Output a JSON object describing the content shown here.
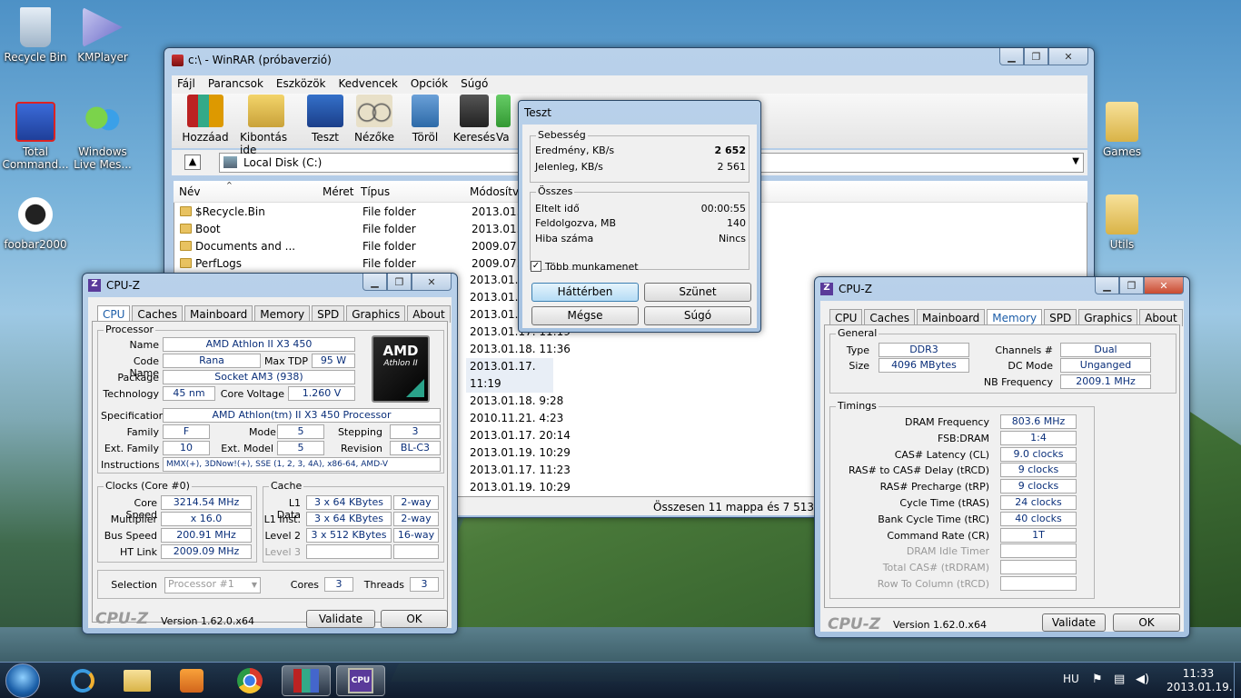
{
  "desktop": {
    "icons": [
      {
        "label": "Recycle Bin"
      },
      {
        "label": "KMPlayer"
      },
      {
        "label": "Total Command..."
      },
      {
        "label": "Windows Live Mes..."
      },
      {
        "label": "foobar2000"
      },
      {
        "label": "Games"
      },
      {
        "label": "Utils"
      }
    ]
  },
  "winrar": {
    "title": "c:\\ - WinRAR (próbaverzió)",
    "menu": [
      "Fájl",
      "Parancsok",
      "Eszközök",
      "Kedvencek",
      "Opciók",
      "Súgó"
    ],
    "toolbar": [
      "Hozzáad",
      "Kibontás ide",
      "Teszt",
      "Nézőke",
      "Töröl",
      "Keresés",
      "Va"
    ],
    "path": "Local Disk (C:)",
    "columns": [
      "Név",
      "Méret",
      "Típus",
      "Módosítva"
    ],
    "rows": [
      {
        "name": "$Recycle.Bin",
        "type": "File folder",
        "date": "2013.01.17"
      },
      {
        "name": "Boot",
        "type": "File folder",
        "date": "2013.01.17"
      },
      {
        "name": "Documents and ...",
        "type": "File folder",
        "date": "2009.07.14"
      },
      {
        "name": "PerfLogs",
        "type": "File folder",
        "date": "2009.07.14"
      }
    ],
    "more_dates": [
      "2013.01.19.",
      "2013.01.18.",
      "2013.01.17.",
      "2013.01.17. 11:19",
      "2013.01.18. 11:36",
      "2013.01.17. 11:19",
      "2013.01.18. 9:28",
      "2010.11.21. 4:23",
      "2013.01.17. 20:14",
      "2013.01.19. 10:29",
      "2013.01.17. 11:23",
      "2013.01.19. 10:29"
    ],
    "status": "Összesen 11 mappa és 7 513 565 2"
  },
  "test": {
    "title": "Teszt",
    "speed_group": "Sebesség",
    "result_label": "Eredmény, KB/s",
    "result_value": "2 652",
    "current_label": "Jelenleg, KB/s",
    "current_value": "2 561",
    "total_group": "Összes",
    "elapsed_label": "Eltelt idő",
    "elapsed_value": "00:00:55",
    "processed_label": "Feldolgozva, MB",
    "processed_value": "140",
    "errors_label": "Hiba száma",
    "errors_value": "Nincs",
    "multitask_label": "Több munkamenet",
    "buttons": [
      "Háttérben",
      "Szünet",
      "Mégse",
      "Súgó"
    ]
  },
  "cpuz1": {
    "title": "CPU-Z",
    "tabs": [
      "CPU",
      "Caches",
      "Mainboard",
      "Memory",
      "SPD",
      "Graphics",
      "About"
    ],
    "processor_group": "Processor",
    "name_l": "Name",
    "name": "AMD Athlon II X3 450",
    "codename_l": "Code Name",
    "codename": "Rana",
    "maxtdp_l": "Max TDP",
    "maxtdp": "95 W",
    "package_l": "Package",
    "package": "Socket AM3 (938)",
    "tech_l": "Technology",
    "tech": "45 nm",
    "voltage_l": "Core Voltage",
    "voltage": "1.260 V",
    "spec_l": "Specification",
    "spec": "AMD Athlon(tm) II X3 450 Processor",
    "family_l": "Family",
    "family": "F",
    "model_l": "Model",
    "model": "5",
    "stepping_l": "Stepping",
    "stepping": "3",
    "extfam_l": "Ext. Family",
    "extfam": "10",
    "extmodel_l": "Ext. Model",
    "extmodel": "5",
    "revision_l": "Revision",
    "revision": "BL-C3",
    "instr_l": "Instructions",
    "instr": "MMX(+), 3DNow!(+), SSE (1, 2, 3, 4A), x86-64, AMD-V",
    "logo_line1": "AMD",
    "logo_line2": "Athlon II",
    "clocks_group": "Clocks (Core #0)",
    "corespeed_l": "Core Speed",
    "corespeed": "3214.54 MHz",
    "mult_l": "Multiplier",
    "mult": "x 16.0",
    "bus_l": "Bus Speed",
    "bus": "200.91 MHz",
    "ht_l": "HT Link",
    "ht": "2009.09 MHz",
    "cache_group": "Cache",
    "l1d_l": "L1 Data",
    "l1d": "3 x 64 KBytes",
    "l1d_w": "2-way",
    "l1i_l": "L1 Inst.",
    "l1i": "3 x 64 KBytes",
    "l1i_w": "2-way",
    "l2_l": "Level 2",
    "l2": "3 x 512 KBytes",
    "l2_w": "16-way",
    "l3_l": "Level 3",
    "selection_l": "Selection",
    "selection": "Processor #1",
    "cores_l": "Cores",
    "cores": "3",
    "threads_l": "Threads",
    "threads": "3",
    "brand": "CPU-Z",
    "version": "Version 1.62.0.x64",
    "validate": "Validate",
    "ok": "OK"
  },
  "cpuz2": {
    "title": "CPU-Z",
    "tabs": [
      "CPU",
      "Caches",
      "Mainboard",
      "Memory",
      "SPD",
      "Graphics",
      "About"
    ],
    "general_group": "General",
    "type_l": "Type",
    "type": "DDR3",
    "channels_l": "Channels #",
    "channels": "Dual",
    "size_l": "Size",
    "size": "4096 MBytes",
    "dcmode_l": "DC Mode",
    "dcmode": "Unganged",
    "nbfreq_l": "NB Frequency",
    "nbfreq": "2009.1 MHz",
    "timings_group": "Timings",
    "timings": [
      {
        "label": "DRAM Frequency",
        "value": "803.6 MHz"
      },
      {
        "label": "FSB:DRAM",
        "value": "1:4"
      },
      {
        "label": "CAS# Latency (CL)",
        "value": "9.0 clocks"
      },
      {
        "label": "RAS# to CAS# Delay (tRCD)",
        "value": "9 clocks"
      },
      {
        "label": "RAS# Precharge (tRP)",
        "value": "9 clocks"
      },
      {
        "label": "Cycle Time (tRAS)",
        "value": "24 clocks"
      },
      {
        "label": "Bank Cycle Time (tRC)",
        "value": "40 clocks"
      },
      {
        "label": "Command Rate (CR)",
        "value": "1T"
      },
      {
        "label": "DRAM Idle Timer",
        "value": ""
      },
      {
        "label": "Total CAS# (tRDRAM)",
        "value": ""
      },
      {
        "label": "Row To Column (tRCD)",
        "value": ""
      }
    ],
    "brand": "CPU-Z",
    "version": "Version 1.62.0.x64",
    "validate": "Validate",
    "ok": "OK"
  },
  "taskbar": {
    "lang": "HU",
    "time": "11:33",
    "date": "2013.01.19."
  }
}
